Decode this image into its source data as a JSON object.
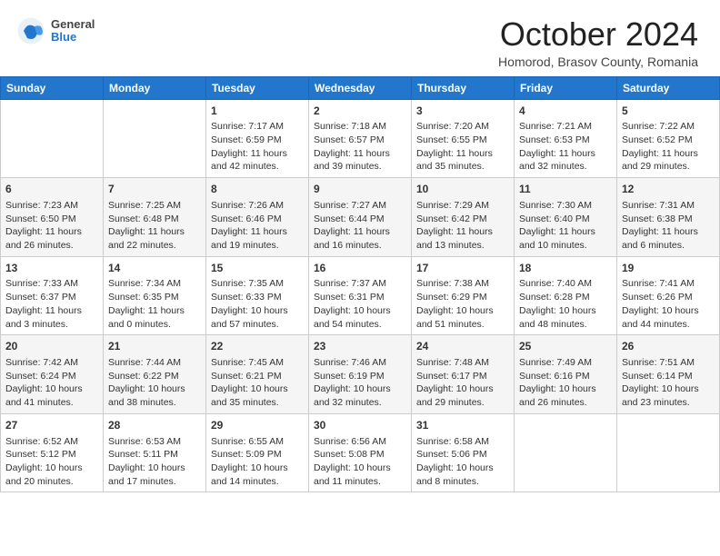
{
  "header": {
    "logo": {
      "general": "General",
      "blue": "Blue"
    },
    "title": "October 2024",
    "subtitle": "Homorod, Brasov County, Romania"
  },
  "days_of_week": [
    "Sunday",
    "Monday",
    "Tuesday",
    "Wednesday",
    "Thursday",
    "Friday",
    "Saturday"
  ],
  "weeks": [
    [
      {
        "day": null,
        "info": null
      },
      {
        "day": null,
        "info": null
      },
      {
        "day": "1",
        "info": "Sunrise: 7:17 AM\nSunset: 6:59 PM\nDaylight: 11 hours and 42 minutes."
      },
      {
        "day": "2",
        "info": "Sunrise: 7:18 AM\nSunset: 6:57 PM\nDaylight: 11 hours and 39 minutes."
      },
      {
        "day": "3",
        "info": "Sunrise: 7:20 AM\nSunset: 6:55 PM\nDaylight: 11 hours and 35 minutes."
      },
      {
        "day": "4",
        "info": "Sunrise: 7:21 AM\nSunset: 6:53 PM\nDaylight: 11 hours and 32 minutes."
      },
      {
        "day": "5",
        "info": "Sunrise: 7:22 AM\nSunset: 6:52 PM\nDaylight: 11 hours and 29 minutes."
      }
    ],
    [
      {
        "day": "6",
        "info": "Sunrise: 7:23 AM\nSunset: 6:50 PM\nDaylight: 11 hours and 26 minutes."
      },
      {
        "day": "7",
        "info": "Sunrise: 7:25 AM\nSunset: 6:48 PM\nDaylight: 11 hours and 22 minutes."
      },
      {
        "day": "8",
        "info": "Sunrise: 7:26 AM\nSunset: 6:46 PM\nDaylight: 11 hours and 19 minutes."
      },
      {
        "day": "9",
        "info": "Sunrise: 7:27 AM\nSunset: 6:44 PM\nDaylight: 11 hours and 16 minutes."
      },
      {
        "day": "10",
        "info": "Sunrise: 7:29 AM\nSunset: 6:42 PM\nDaylight: 11 hours and 13 minutes."
      },
      {
        "day": "11",
        "info": "Sunrise: 7:30 AM\nSunset: 6:40 PM\nDaylight: 11 hours and 10 minutes."
      },
      {
        "day": "12",
        "info": "Sunrise: 7:31 AM\nSunset: 6:38 PM\nDaylight: 11 hours and 6 minutes."
      }
    ],
    [
      {
        "day": "13",
        "info": "Sunrise: 7:33 AM\nSunset: 6:37 PM\nDaylight: 11 hours and 3 minutes."
      },
      {
        "day": "14",
        "info": "Sunrise: 7:34 AM\nSunset: 6:35 PM\nDaylight: 11 hours and 0 minutes."
      },
      {
        "day": "15",
        "info": "Sunrise: 7:35 AM\nSunset: 6:33 PM\nDaylight: 10 hours and 57 minutes."
      },
      {
        "day": "16",
        "info": "Sunrise: 7:37 AM\nSunset: 6:31 PM\nDaylight: 10 hours and 54 minutes."
      },
      {
        "day": "17",
        "info": "Sunrise: 7:38 AM\nSunset: 6:29 PM\nDaylight: 10 hours and 51 minutes."
      },
      {
        "day": "18",
        "info": "Sunrise: 7:40 AM\nSunset: 6:28 PM\nDaylight: 10 hours and 48 minutes."
      },
      {
        "day": "19",
        "info": "Sunrise: 7:41 AM\nSunset: 6:26 PM\nDaylight: 10 hours and 44 minutes."
      }
    ],
    [
      {
        "day": "20",
        "info": "Sunrise: 7:42 AM\nSunset: 6:24 PM\nDaylight: 10 hours and 41 minutes."
      },
      {
        "day": "21",
        "info": "Sunrise: 7:44 AM\nSunset: 6:22 PM\nDaylight: 10 hours and 38 minutes."
      },
      {
        "day": "22",
        "info": "Sunrise: 7:45 AM\nSunset: 6:21 PM\nDaylight: 10 hours and 35 minutes."
      },
      {
        "day": "23",
        "info": "Sunrise: 7:46 AM\nSunset: 6:19 PM\nDaylight: 10 hours and 32 minutes."
      },
      {
        "day": "24",
        "info": "Sunrise: 7:48 AM\nSunset: 6:17 PM\nDaylight: 10 hours and 29 minutes."
      },
      {
        "day": "25",
        "info": "Sunrise: 7:49 AM\nSunset: 6:16 PM\nDaylight: 10 hours and 26 minutes."
      },
      {
        "day": "26",
        "info": "Sunrise: 7:51 AM\nSunset: 6:14 PM\nDaylight: 10 hours and 23 minutes."
      }
    ],
    [
      {
        "day": "27",
        "info": "Sunrise: 6:52 AM\nSunset: 5:12 PM\nDaylight: 10 hours and 20 minutes."
      },
      {
        "day": "28",
        "info": "Sunrise: 6:53 AM\nSunset: 5:11 PM\nDaylight: 10 hours and 17 minutes."
      },
      {
        "day": "29",
        "info": "Sunrise: 6:55 AM\nSunset: 5:09 PM\nDaylight: 10 hours and 14 minutes."
      },
      {
        "day": "30",
        "info": "Sunrise: 6:56 AM\nSunset: 5:08 PM\nDaylight: 10 hours and 11 minutes."
      },
      {
        "day": "31",
        "info": "Sunrise: 6:58 AM\nSunset: 5:06 PM\nDaylight: 10 hours and 8 minutes."
      },
      {
        "day": null,
        "info": null
      },
      {
        "day": null,
        "info": null
      }
    ]
  ]
}
